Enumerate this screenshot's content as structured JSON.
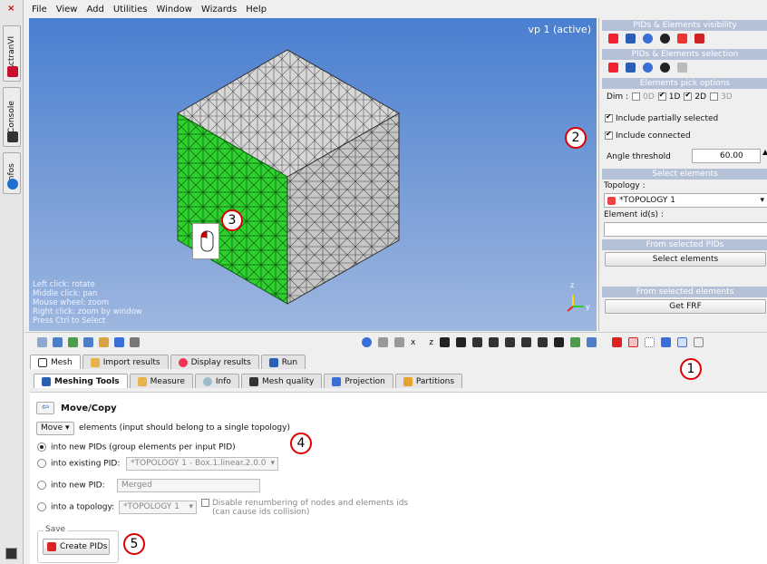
{
  "menu": [
    "File",
    "View",
    "Add",
    "Utilities",
    "Window",
    "Wizards",
    "Help"
  ],
  "sidebar": {
    "actranvi": "ActranVI",
    "console": "Console",
    "infos": "Infos"
  },
  "viewport": {
    "title": "vp 1 (active)",
    "hints": [
      "Left click: rotate",
      "Middle click: pan",
      "Mouse wheel: zoom",
      "Right click: zoom by window",
      "Press Ctrl to Select"
    ],
    "axis_z": "z",
    "axis_y": "y"
  },
  "right_panel": {
    "visibility_header": "PIDs & Elements visibility",
    "selection_header": "PIDs & Elements selection",
    "pick_header": "Elements pick options",
    "dim_label": "Dim :",
    "dims": [
      {
        "label": "0D",
        "checked": false
      },
      {
        "label": "1D",
        "checked": true
      },
      {
        "label": "2D",
        "checked": true
      },
      {
        "label": "3D",
        "checked": false
      }
    ],
    "include_partial": "Include partially selected",
    "include_connected": "Include connected",
    "angle_label": "Angle threshold",
    "angle_value": "60.00",
    "select_header": "Select elements",
    "topology_label": "Topology :",
    "topology_value": "*TOPOLOGY 1",
    "element_ids_label": "Element id(s) :",
    "from_pids_header": "From selected PIDs",
    "select_elements_button": "Select elements",
    "from_elements_header": "From selected elements",
    "get_frf_button": "Get FRF"
  },
  "toolbar": {
    "x_label": "x",
    "z_label": "z"
  },
  "main_tabs": [
    "Mesh",
    "Import results",
    "Display results",
    "Run"
  ],
  "sub_tabs": [
    "Meshing Tools",
    "Measure",
    "Info",
    "Mesh quality",
    "Projection",
    "Partitions"
  ],
  "move": {
    "title": "Move/Copy",
    "op_value": "Move",
    "op_desc": "elements (input should belong to a single topology)",
    "opt_new_pids": "into new PIDs (group elements per input PID)",
    "opt_existing": "into existing PID:",
    "existing_value": "*TOPOLOGY 1 - Box.1.linear.2.0.0",
    "opt_new_pid": "into new PID:",
    "new_pid_value": "Merged",
    "opt_topology": "into a topology:",
    "topology_value": "*TOPOLOGY 1",
    "disable_renum": "Disable renumbering of nodes and elements ids",
    "disable_renum2": "(can cause ids collision)",
    "save_legend": "Save",
    "create_button": "Create PIDs"
  },
  "callouts": [
    "1",
    "2",
    "3",
    "4",
    "5"
  ],
  "colors": {
    "viewport_top": "#4a7fd0",
    "viewport_bottom": "#9eb7df",
    "selected_face": "#2fcf2f",
    "header": "#b4c1d6",
    "callout": "#dd0000"
  }
}
